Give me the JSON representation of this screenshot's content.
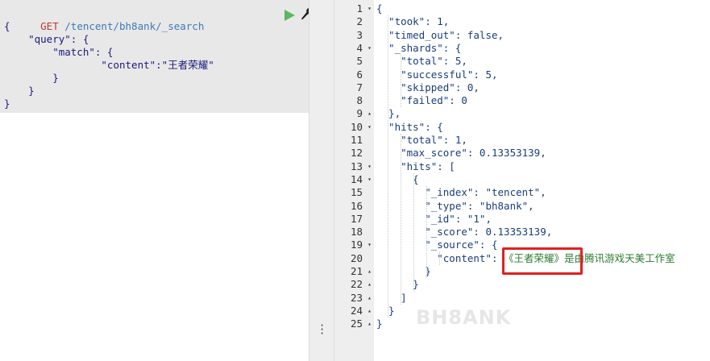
{
  "request": {
    "method": "GET",
    "path": "/tencent/bh8ank/_search",
    "body_lines": [
      "{",
      "    \"query\": {",
      "        \"match\": {",
      "                \"content\":\"王者荣耀\"",
      "        }",
      "    }",
      "}"
    ]
  },
  "icons": {
    "run": "play-icon",
    "settings": "wrench-icon",
    "handle": "vertical-dots-icon"
  },
  "response": {
    "lines": [
      {
        "n": "1",
        "fold": "▾",
        "text": "{"
      },
      {
        "n": "2",
        "fold": "",
        "text": "  \"took\": 1,"
      },
      {
        "n": "3",
        "fold": "",
        "text": "  \"timed_out\": false,"
      },
      {
        "n": "4",
        "fold": "▾",
        "text": "  \"_shards\": {"
      },
      {
        "n": "5",
        "fold": "",
        "text": "    \"total\": 5,"
      },
      {
        "n": "6",
        "fold": "",
        "text": "    \"successful\": 5,"
      },
      {
        "n": "7",
        "fold": "",
        "text": "    \"skipped\": 0,"
      },
      {
        "n": "8",
        "fold": "",
        "text": "    \"failed\": 0"
      },
      {
        "n": "9",
        "fold": "▴",
        "text": "  },"
      },
      {
        "n": "10",
        "fold": "▾",
        "text": "  \"hits\": {"
      },
      {
        "n": "11",
        "fold": "",
        "text": "    \"total\": 1,"
      },
      {
        "n": "12",
        "fold": "",
        "text": "    \"max_score\": 0.13353139,"
      },
      {
        "n": "13",
        "fold": "▾",
        "text": "    \"hits\": ["
      },
      {
        "n": "14",
        "fold": "▾",
        "text": "      {"
      },
      {
        "n": "15",
        "fold": "",
        "text": "        \"_index\": \"tencent\","
      },
      {
        "n": "16",
        "fold": "",
        "text": "        \"_type\": \"bh8ank\","
      },
      {
        "n": "17",
        "fold": "",
        "text": "        \"_id\": \"1\","
      },
      {
        "n": "18",
        "fold": "",
        "text": "        \"_score\": 0.13353139,"
      },
      {
        "n": "19",
        "fold": "▾",
        "text": "        \"_source\": {"
      },
      {
        "n": "20",
        "fold": "",
        "text": "          \"content\": "
      },
      {
        "n": "21",
        "fold": "▴",
        "text": "        }"
      },
      {
        "n": "22",
        "fold": "▴",
        "text": "      }"
      },
      {
        "n": "23",
        "fold": "▴",
        "text": "    ]"
      },
      {
        "n": "24",
        "fold": "▴",
        "text": "  }"
      },
      {
        "n": "25",
        "fold": "▴",
        "text": "}"
      }
    ],
    "content_value_highlight": "《王者荣耀》",
    "content_value_rest": "是由腾讯游戏天美工作室"
  },
  "watermark": "BH8ANK",
  "colors": {
    "highlight": "#e02020",
    "method": "#c0392b",
    "path": "#3d7ab8"
  }
}
